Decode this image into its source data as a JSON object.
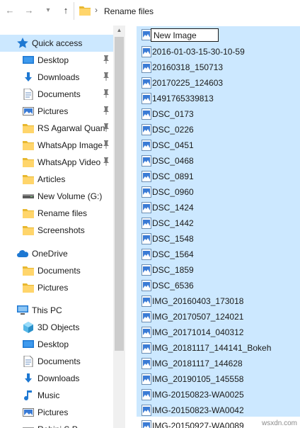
{
  "address_bar": {
    "back_glyph": "←",
    "forward_glyph": "→",
    "dropdown_glyph": "▾",
    "up_glyph": "↑",
    "separator": "›",
    "path": "Rename files"
  },
  "navigation_pane": {
    "quick_access": {
      "label": "Quick access",
      "items": [
        {
          "label": "Desktop",
          "icon": "desktop-icon",
          "pinned": true
        },
        {
          "label": "Downloads",
          "icon": "downloads-icon",
          "pinned": true
        },
        {
          "label": "Documents",
          "icon": "documents-icon",
          "pinned": true
        },
        {
          "label": "Pictures",
          "icon": "pictures-icon",
          "pinned": true
        },
        {
          "label": "RS Agarwal Quan",
          "icon": "folder-icon",
          "pinned": true
        },
        {
          "label": "WhatsApp Image",
          "icon": "folder-icon",
          "pinned": true
        },
        {
          "label": "WhatsApp Video",
          "icon": "folder-icon",
          "pinned": true
        },
        {
          "label": "Articles",
          "icon": "folder-icon",
          "pinned": false
        },
        {
          "label": "New Volume (G:)",
          "icon": "drive-icon",
          "pinned": false
        },
        {
          "label": "Rename files",
          "icon": "folder-icon",
          "pinned": false
        },
        {
          "label": "Screenshots",
          "icon": "folder-icon",
          "pinned": false
        }
      ]
    },
    "onedrive": {
      "label": "OneDrive",
      "items": [
        {
          "label": "Documents",
          "icon": "folder-icon"
        },
        {
          "label": "Pictures",
          "icon": "folder-icon"
        }
      ]
    },
    "this_pc": {
      "label": "This PC",
      "items": [
        {
          "label": "3D Objects",
          "icon": "3d-objects-icon"
        },
        {
          "label": "Desktop",
          "icon": "desktop-icon"
        },
        {
          "label": "Documents",
          "icon": "documents-icon"
        },
        {
          "label": "Downloads",
          "icon": "downloads-icon"
        },
        {
          "label": "Music",
          "icon": "music-icon"
        },
        {
          "label": "Pictures",
          "icon": "pictures-icon"
        }
      ]
    },
    "partial_last_label": "Rohini S P..."
  },
  "file_list": {
    "rename_value": "New Image",
    "files": [
      "2016-01-03-15-30-10-59",
      "20160318_150713",
      "20170225_124603",
      "1491765339813",
      "DSC_0173",
      "DSC_0226",
      "DSC_0451",
      "DSC_0468",
      "DSC_0891",
      "DSC_0960",
      "DSC_1424",
      "DSC_1442",
      "DSC_1548",
      "DSC_1564",
      "DSC_1859",
      "DSC_6536",
      "IMG_20160403_173018",
      "IMG_20170507_124021",
      "IMG_20171014_040312",
      "IMG_20181117_144141_Bokeh",
      "IMG_20181117_144628",
      "IMG_20190105_145558",
      "IMG-20150823-WA0025",
      "IMG-20150823-WA0042",
      "IMG-20150927-WA0089"
    ]
  },
  "watermark": "wsxdn.com",
  "colors": {
    "selection": "#cce8ff",
    "folder": "#ffd56b",
    "accent_blue": "#1a73c9",
    "scrollbar_track": "#f0f0f0",
    "scrollbar_thumb": "#cdcdcd"
  }
}
